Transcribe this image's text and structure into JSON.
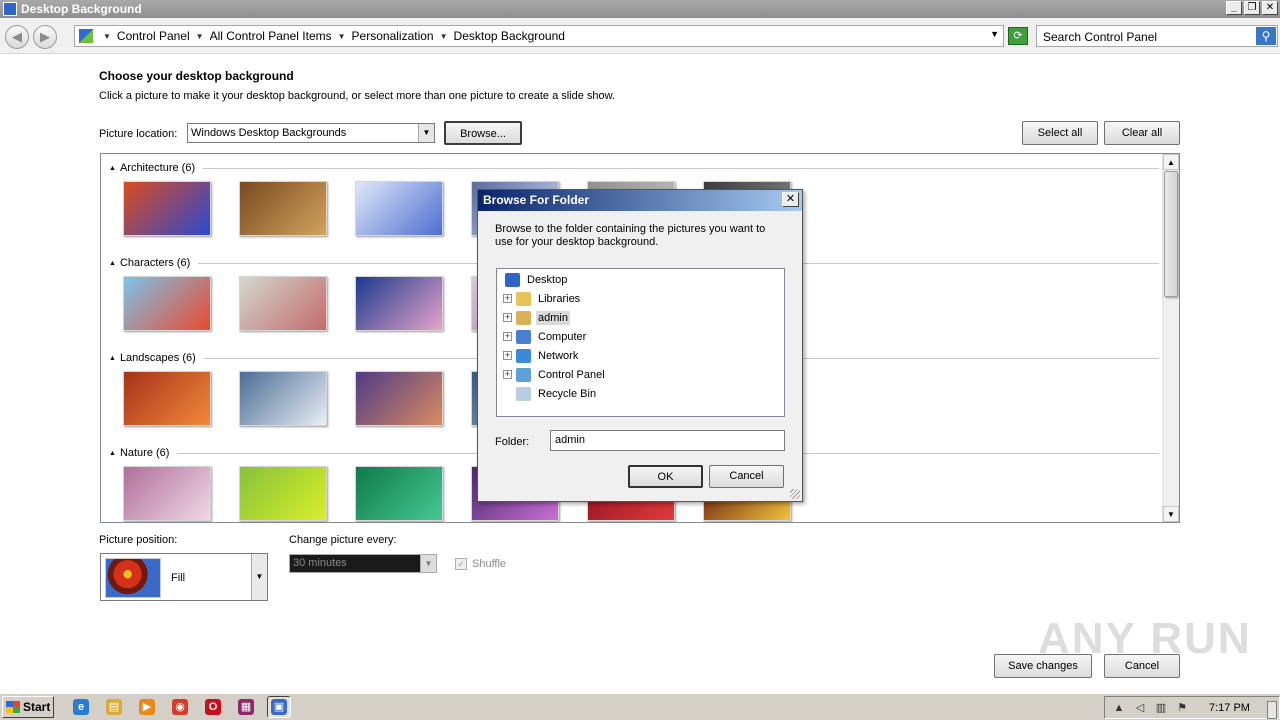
{
  "window": {
    "title": "Desktop Background"
  },
  "address": {
    "crumbs": [
      "Control Panel",
      "All Control Panel Items",
      "Personalization",
      "Desktop Background"
    ],
    "search_placeholder": "Search Control Panel"
  },
  "main": {
    "heading": "Choose your desktop background",
    "subtext": "Click a picture to make it your desktop background, or select more than one picture to create a slide show.",
    "location_label": "Picture location:",
    "location_value": "Windows Desktop Backgrounds",
    "browse_label": "Browse...",
    "select_all_label": "Select all",
    "clear_all_label": "Clear all",
    "groups": [
      {
        "label": "Architecture (6)",
        "colors": [
          [
            "#d94b1e",
            "#2b4ad0"
          ],
          [
            "#7a4a22",
            "#d1a35c"
          ],
          [
            "#dfe8f8",
            "#4d6ed1"
          ],
          [
            "#5a6c9e",
            "#cfd8ef"
          ],
          [
            "#8f8f8f",
            "#c9c9c9"
          ],
          [
            "#3b3b3b",
            "#909090"
          ]
        ]
      },
      {
        "label": "Characters (6)",
        "colors": [
          [
            "#7cc4ea",
            "#e74a2e"
          ],
          [
            "#d2d7cf",
            "#c26b6b"
          ],
          [
            "#1a3a8f",
            "#e6a3c8"
          ],
          [
            "#d6c9d6",
            "#9f7da8"
          ],
          [
            "#efe3d0",
            "#aa6a3a"
          ],
          [
            "#9ed0e8",
            "#3b6f2b"
          ]
        ]
      },
      {
        "label": "Landscapes (6)",
        "colors": [
          [
            "#a8321a",
            "#f08a3a"
          ],
          [
            "#4a6d94",
            "#e9eef5"
          ],
          [
            "#4e3c86",
            "#d98b5f"
          ],
          [
            "#395a7a",
            "#a0b7cc"
          ],
          [
            "#6a7b39",
            "#c7b35e"
          ],
          [
            "#1f3f6a",
            "#e7c470"
          ]
        ]
      },
      {
        "label": "Nature (6)",
        "colors": [
          [
            "#b06f9a",
            "#f0d8e6"
          ],
          [
            "#86c23a",
            "#d8ee2a"
          ],
          [
            "#0f7a4a",
            "#46c892"
          ],
          [
            "#4b2a6a",
            "#c96fd6"
          ],
          [
            "#8a0f1f",
            "#e03a3a"
          ],
          [
            "#5a0f0f",
            "#f2c23a"
          ]
        ]
      }
    ]
  },
  "bottom": {
    "position_label": "Picture position:",
    "position_value": "Fill",
    "change_label": "Change picture every:",
    "change_value": "30 minutes",
    "shuffle_label": "Shuffle",
    "save_label": "Save changes",
    "cancel_label": "Cancel"
  },
  "dialog": {
    "title": "Browse For Folder",
    "instructions": "Browse to the folder containing the pictures you want to use for your desktop background.",
    "tree": [
      {
        "label": "Desktop",
        "expandable": false,
        "icon": "desktop-icon",
        "color": "#2e66c8",
        "indent": 0,
        "selected": false
      },
      {
        "label": "Libraries",
        "expandable": true,
        "icon": "libraries-icon",
        "color": "#e8c25a",
        "indent": 1,
        "selected": false
      },
      {
        "label": "admin",
        "expandable": true,
        "icon": "user-folder-icon",
        "color": "#d9b15a",
        "indent": 1,
        "selected": true
      },
      {
        "label": "Computer",
        "expandable": true,
        "icon": "computer-icon",
        "color": "#4a7fd0",
        "indent": 1,
        "selected": false
      },
      {
        "label": "Network",
        "expandable": true,
        "icon": "network-icon",
        "color": "#3a8ad8",
        "indent": 1,
        "selected": false
      },
      {
        "label": "Control Panel",
        "expandable": true,
        "icon": "control-panel-icon",
        "color": "#5fa0d8",
        "indent": 1,
        "selected": false
      },
      {
        "label": "Recycle Bin",
        "expandable": false,
        "icon": "recycle-bin-icon",
        "color": "#b8cde0",
        "indent": 1,
        "selected": false
      }
    ],
    "folder_label": "Folder:",
    "folder_value": "admin",
    "ok_label": "OK",
    "cancel_label": "Cancel"
  },
  "taskbar": {
    "start_label": "Start",
    "apps": [
      {
        "name": "ie-icon",
        "glyph": "e",
        "color": "#2a7bd6"
      },
      {
        "name": "explorer-icon",
        "glyph": "▤",
        "color": "#d9a93a"
      },
      {
        "name": "media-player-icon",
        "glyph": "▶",
        "color": "#e88a1a"
      },
      {
        "name": "chrome-icon",
        "glyph": "◉",
        "color": "#d63a2a"
      },
      {
        "name": "opera-icon",
        "glyph": "O",
        "color": "#c8101a"
      },
      {
        "name": "winrar-icon",
        "glyph": "▦",
        "color": "#8a2a6a"
      },
      {
        "name": "control-panel-task-icon",
        "glyph": "▣",
        "color": "#3a6ac8"
      }
    ],
    "clock": "7:17 PM"
  },
  "watermark": "ANY RUN"
}
